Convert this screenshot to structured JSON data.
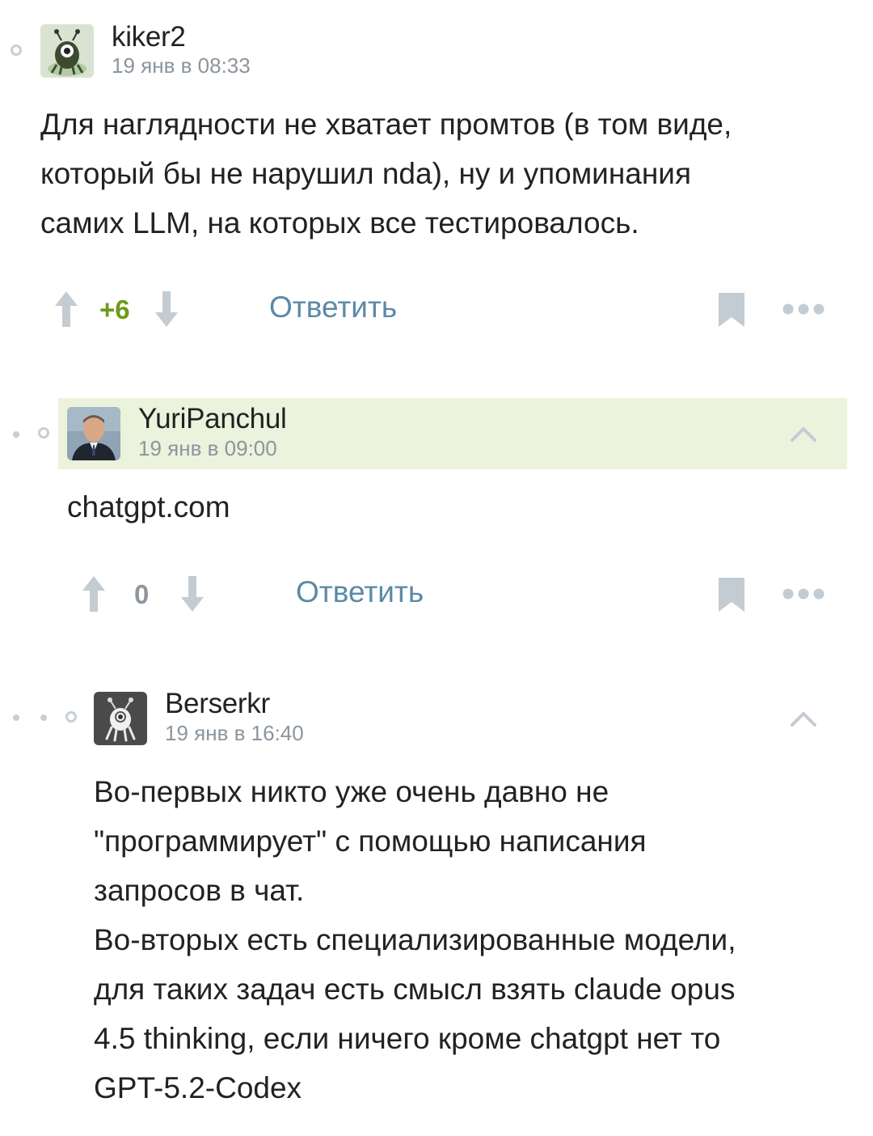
{
  "comments": [
    {
      "username": "kiker2",
      "timestamp": "19 янв в 08:33",
      "text_lines": [
        "Для наглядности не хватает промтов (в том виде,",
        "который бы не нарушил nda), ну и упоминания",
        "самих LLM, на которых все тестировалось."
      ],
      "score": "+6",
      "reply_label": "Ответить"
    },
    {
      "username": "YuriPanchul",
      "timestamp": "19 янв в 09:00",
      "text_lines": [
        "chatgpt.com"
      ],
      "score": "0",
      "reply_label": "Ответить"
    },
    {
      "username": "Berserkr",
      "timestamp": "19 янв в 16:40",
      "text_lines": [
        "Во-первых никто уже очень давно не",
        "\"программирует\" с помощью написания",
        "запросов в чат.",
        "Во-вторых есть специализированные модели,",
        "для таких задач есть смысл взять claude opus",
        "4.5 thinking, если ничего кроме chatgpt нет то",
        "GPT-5.2-Codex"
      ]
    }
  ],
  "colors": {
    "highlight": "#ebf3dd",
    "reply": "#5a8aa6",
    "score_positive": "#6c9a1b",
    "score_zero": "#8e979f",
    "icon_gray": "#c3ccd3"
  },
  "icons": [
    "up-arrow",
    "down-arrow",
    "bookmark",
    "more-dots",
    "chevron-up",
    "thread-dot",
    "thread-ring"
  ]
}
